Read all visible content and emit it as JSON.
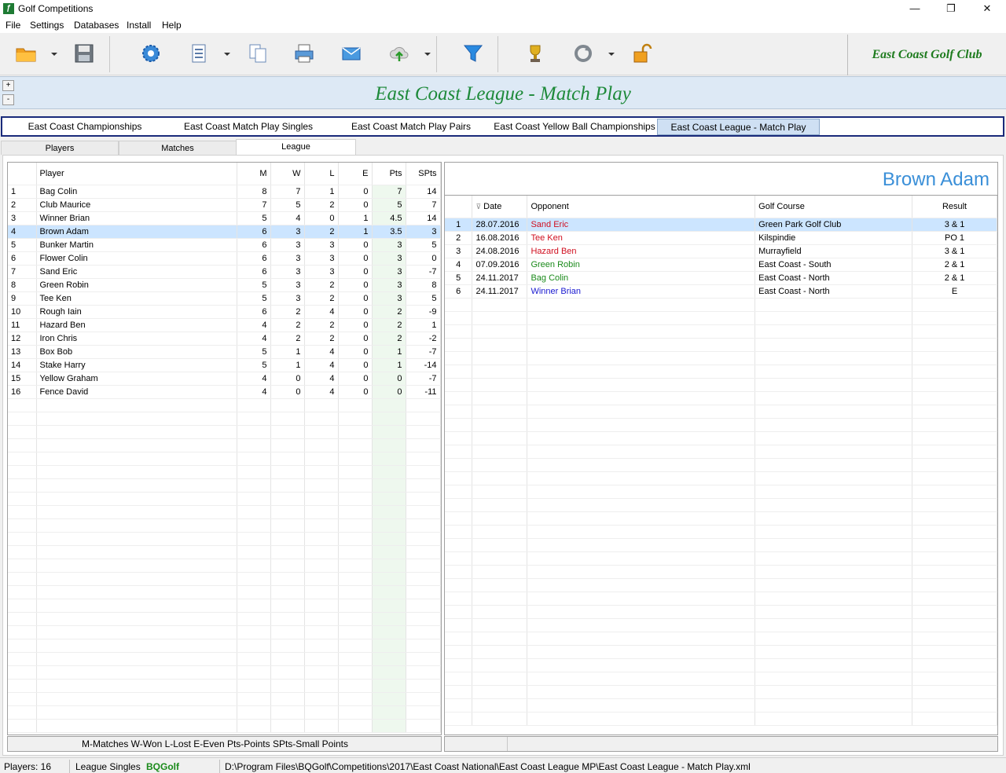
{
  "window": {
    "title": "Golf Competitions",
    "minimize": "—",
    "restore": "❐",
    "close": "✕"
  },
  "menu": [
    "File",
    "Settings",
    "Databases",
    "Install",
    "Help"
  ],
  "club_name": "East Coast Golf Club",
  "banner": {
    "title": "East Coast League - Match Play",
    "expand": "+",
    "collapse": "-"
  },
  "competition_tabs": [
    "East Coast Championships",
    "East Coast Match Play Singles",
    "East Coast Match Play Pairs",
    "East Coast Yellow Ball Championships",
    "East Coast League - Match Play"
  ],
  "sub_tabs": [
    "Players",
    "Matches",
    "League"
  ],
  "league": {
    "headers": {
      "player": "Player",
      "m": "M",
      "w": "W",
      "l": "L",
      "e": "E",
      "pts": "Pts",
      "spts": "SPts"
    },
    "rows": [
      {
        "n": "1",
        "player": "Bag Colin",
        "m": "8",
        "w": "7",
        "l": "1",
        "e": "0",
        "pts": "7",
        "spts": "14"
      },
      {
        "n": "2",
        "player": "Club Maurice",
        "m": "7",
        "w": "5",
        "l": "2",
        "e": "0",
        "pts": "5",
        "spts": "7"
      },
      {
        "n": "3",
        "player": "Winner Brian",
        "m": "5",
        "w": "4",
        "l": "0",
        "e": "1",
        "pts": "4.5",
        "spts": "14"
      },
      {
        "n": "4",
        "player": "Brown Adam",
        "m": "6",
        "w": "3",
        "l": "2",
        "e": "1",
        "pts": "3.5",
        "spts": "3"
      },
      {
        "n": "5",
        "player": "Bunker Martin",
        "m": "6",
        "w": "3",
        "l": "3",
        "e": "0",
        "pts": "3",
        "spts": "5"
      },
      {
        "n": "6",
        "player": "Flower Colin",
        "m": "6",
        "w": "3",
        "l": "3",
        "e": "0",
        "pts": "3",
        "spts": "0"
      },
      {
        "n": "7",
        "player": "Sand Eric",
        "m": "6",
        "w": "3",
        "l": "3",
        "e": "0",
        "pts": "3",
        "spts": "-7"
      },
      {
        "n": "8",
        "player": "Green Robin",
        "m": "5",
        "w": "3",
        "l": "2",
        "e": "0",
        "pts": "3",
        "spts": "8"
      },
      {
        "n": "9",
        "player": "Tee Ken",
        "m": "5",
        "w": "3",
        "l": "2",
        "e": "0",
        "pts": "3",
        "spts": "5"
      },
      {
        "n": "10",
        "player": "Rough Iain",
        "m": "6",
        "w": "2",
        "l": "4",
        "e": "0",
        "pts": "2",
        "spts": "-9"
      },
      {
        "n": "11",
        "player": "Hazard Ben",
        "m": "4",
        "w": "2",
        "l": "2",
        "e": "0",
        "pts": "2",
        "spts": "1"
      },
      {
        "n": "12",
        "player": "Iron Chris",
        "m": "4",
        "w": "2",
        "l": "2",
        "e": "0",
        "pts": "2",
        "spts": "-2"
      },
      {
        "n": "13",
        "player": "Box Bob",
        "m": "5",
        "w": "1",
        "l": "4",
        "e": "0",
        "pts": "1",
        "spts": "-7"
      },
      {
        "n": "14",
        "player": "Stake Harry",
        "m": "5",
        "w": "1",
        "l": "4",
        "e": "0",
        "pts": "1",
        "spts": "-14"
      },
      {
        "n": "15",
        "player": "Yellow Graham",
        "m": "4",
        "w": "0",
        "l": "4",
        "e": "0",
        "pts": "0",
        "spts": "-7"
      },
      {
        "n": "16",
        "player": "Fence David",
        "m": "4",
        "w": "0",
        "l": "4",
        "e": "0",
        "pts": "0",
        "spts": "-11"
      }
    ],
    "selected_index": 3,
    "legend": "M-Matches  W-Won  L-Lost  E-Even  Pts-Points  SPts-Small Points"
  },
  "player_matches": {
    "player_name": "Brown Adam",
    "headers": {
      "date": "Date",
      "opponent": "Opponent",
      "course": "Golf Course",
      "result": "Result"
    },
    "sort_icon": "⊽",
    "rows": [
      {
        "n": "1",
        "date": "28.07.2016",
        "opponent": "Sand Eric",
        "color": "#d01020",
        "course": "Green Park Golf Club",
        "result": "3 & 1"
      },
      {
        "n": "2",
        "date": "16.08.2016",
        "opponent": "Tee Ken",
        "color": "#d01020",
        "course": "Kilspindie",
        "result": "PO 1"
      },
      {
        "n": "3",
        "date": "24.08.2016",
        "opponent": "Hazard Ben",
        "color": "#d01020",
        "course": "Murrayfield",
        "result": "3 & 1"
      },
      {
        "n": "4",
        "date": "07.09.2016",
        "opponent": "Green Robin",
        "color": "#1a8a1a",
        "course": "East Coast - South",
        "result": "2 & 1"
      },
      {
        "n": "5",
        "date": "24.11.2017",
        "opponent": "Bag Colin",
        "color": "#1a8a1a",
        "course": "East Coast - North",
        "result": "2 & 1"
      },
      {
        "n": "6",
        "date": "24.11.2017",
        "opponent": "Winner Brian",
        "color": "#1a1ad0",
        "course": "East Coast - North",
        "result": "E"
      }
    ]
  },
  "status": {
    "players": "Players: 16",
    "mode": "League Singles",
    "app": "BQGolf",
    "path": "D:\\Program Files\\BQGolf\\Competitions\\2017\\East Coast National\\East Coast League MP\\East Coast League - Match Play.xml"
  }
}
